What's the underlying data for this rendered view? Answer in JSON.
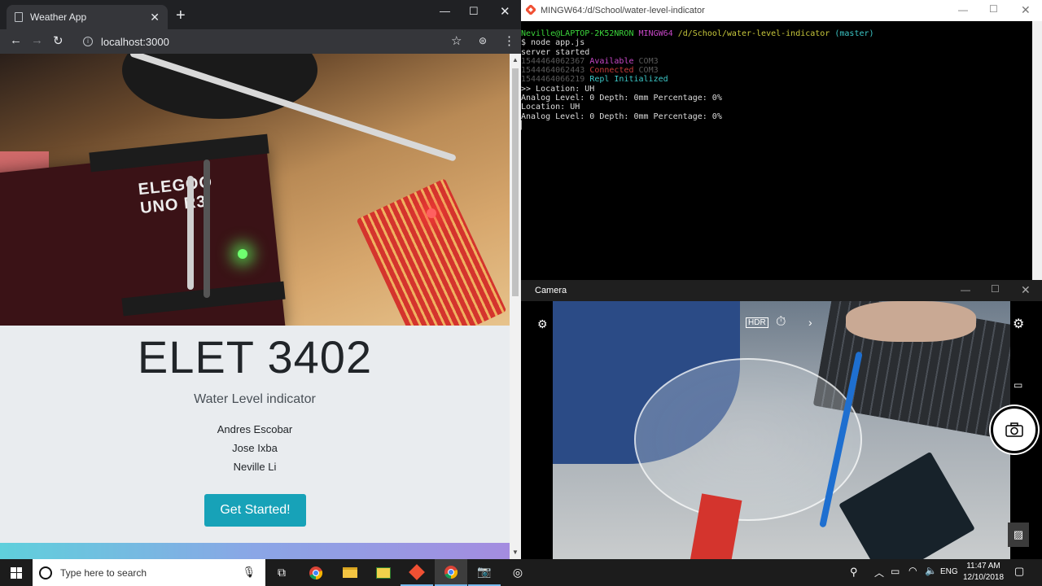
{
  "chrome": {
    "tab_title": "Weather App",
    "tab_close": "✕",
    "new_tab": "+",
    "url": "localhost:3000",
    "page": {
      "title": "ELET 3402",
      "subtitle": "Water Level indicator",
      "members": [
        "Andres Escobar",
        "Jose Ixba",
        "Neville Li"
      ],
      "cta_label": "Get Started!",
      "board_text": "ELEGOO UNO R3"
    }
  },
  "terminal": {
    "title": "MINGW64:/d/School/water-level-indicator",
    "prompt_user": "Neville@LAPTOP-2K52NRON",
    "prompt_shell": "MINGW64",
    "prompt_path": "/d/School/water-level-indicator",
    "prompt_branch": "(master)",
    "command": "$ node app.js",
    "lines": [
      "server started",
      {
        "ts": "1544464062367",
        "status": "Available",
        "port": "COM3"
      },
      {
        "ts": "1544464062443",
        "status": "Connected",
        "port": "COM3"
      },
      {
        "ts": "1544464066219",
        "status": "Repl Initialized",
        "port": ""
      },
      ">> Location: UH",
      "Analog Level: 0 Depth: 0mm Percentage: 0%",
      "Location: UH",
      "Analog Level: 0 Depth: 0mm Percentage: 0%"
    ]
  },
  "camera": {
    "title": "Camera"
  },
  "taskbar": {
    "search_placeholder": "Type here to search",
    "language": "ENG",
    "time": "11:47 AM",
    "date": "12/10/2018"
  }
}
